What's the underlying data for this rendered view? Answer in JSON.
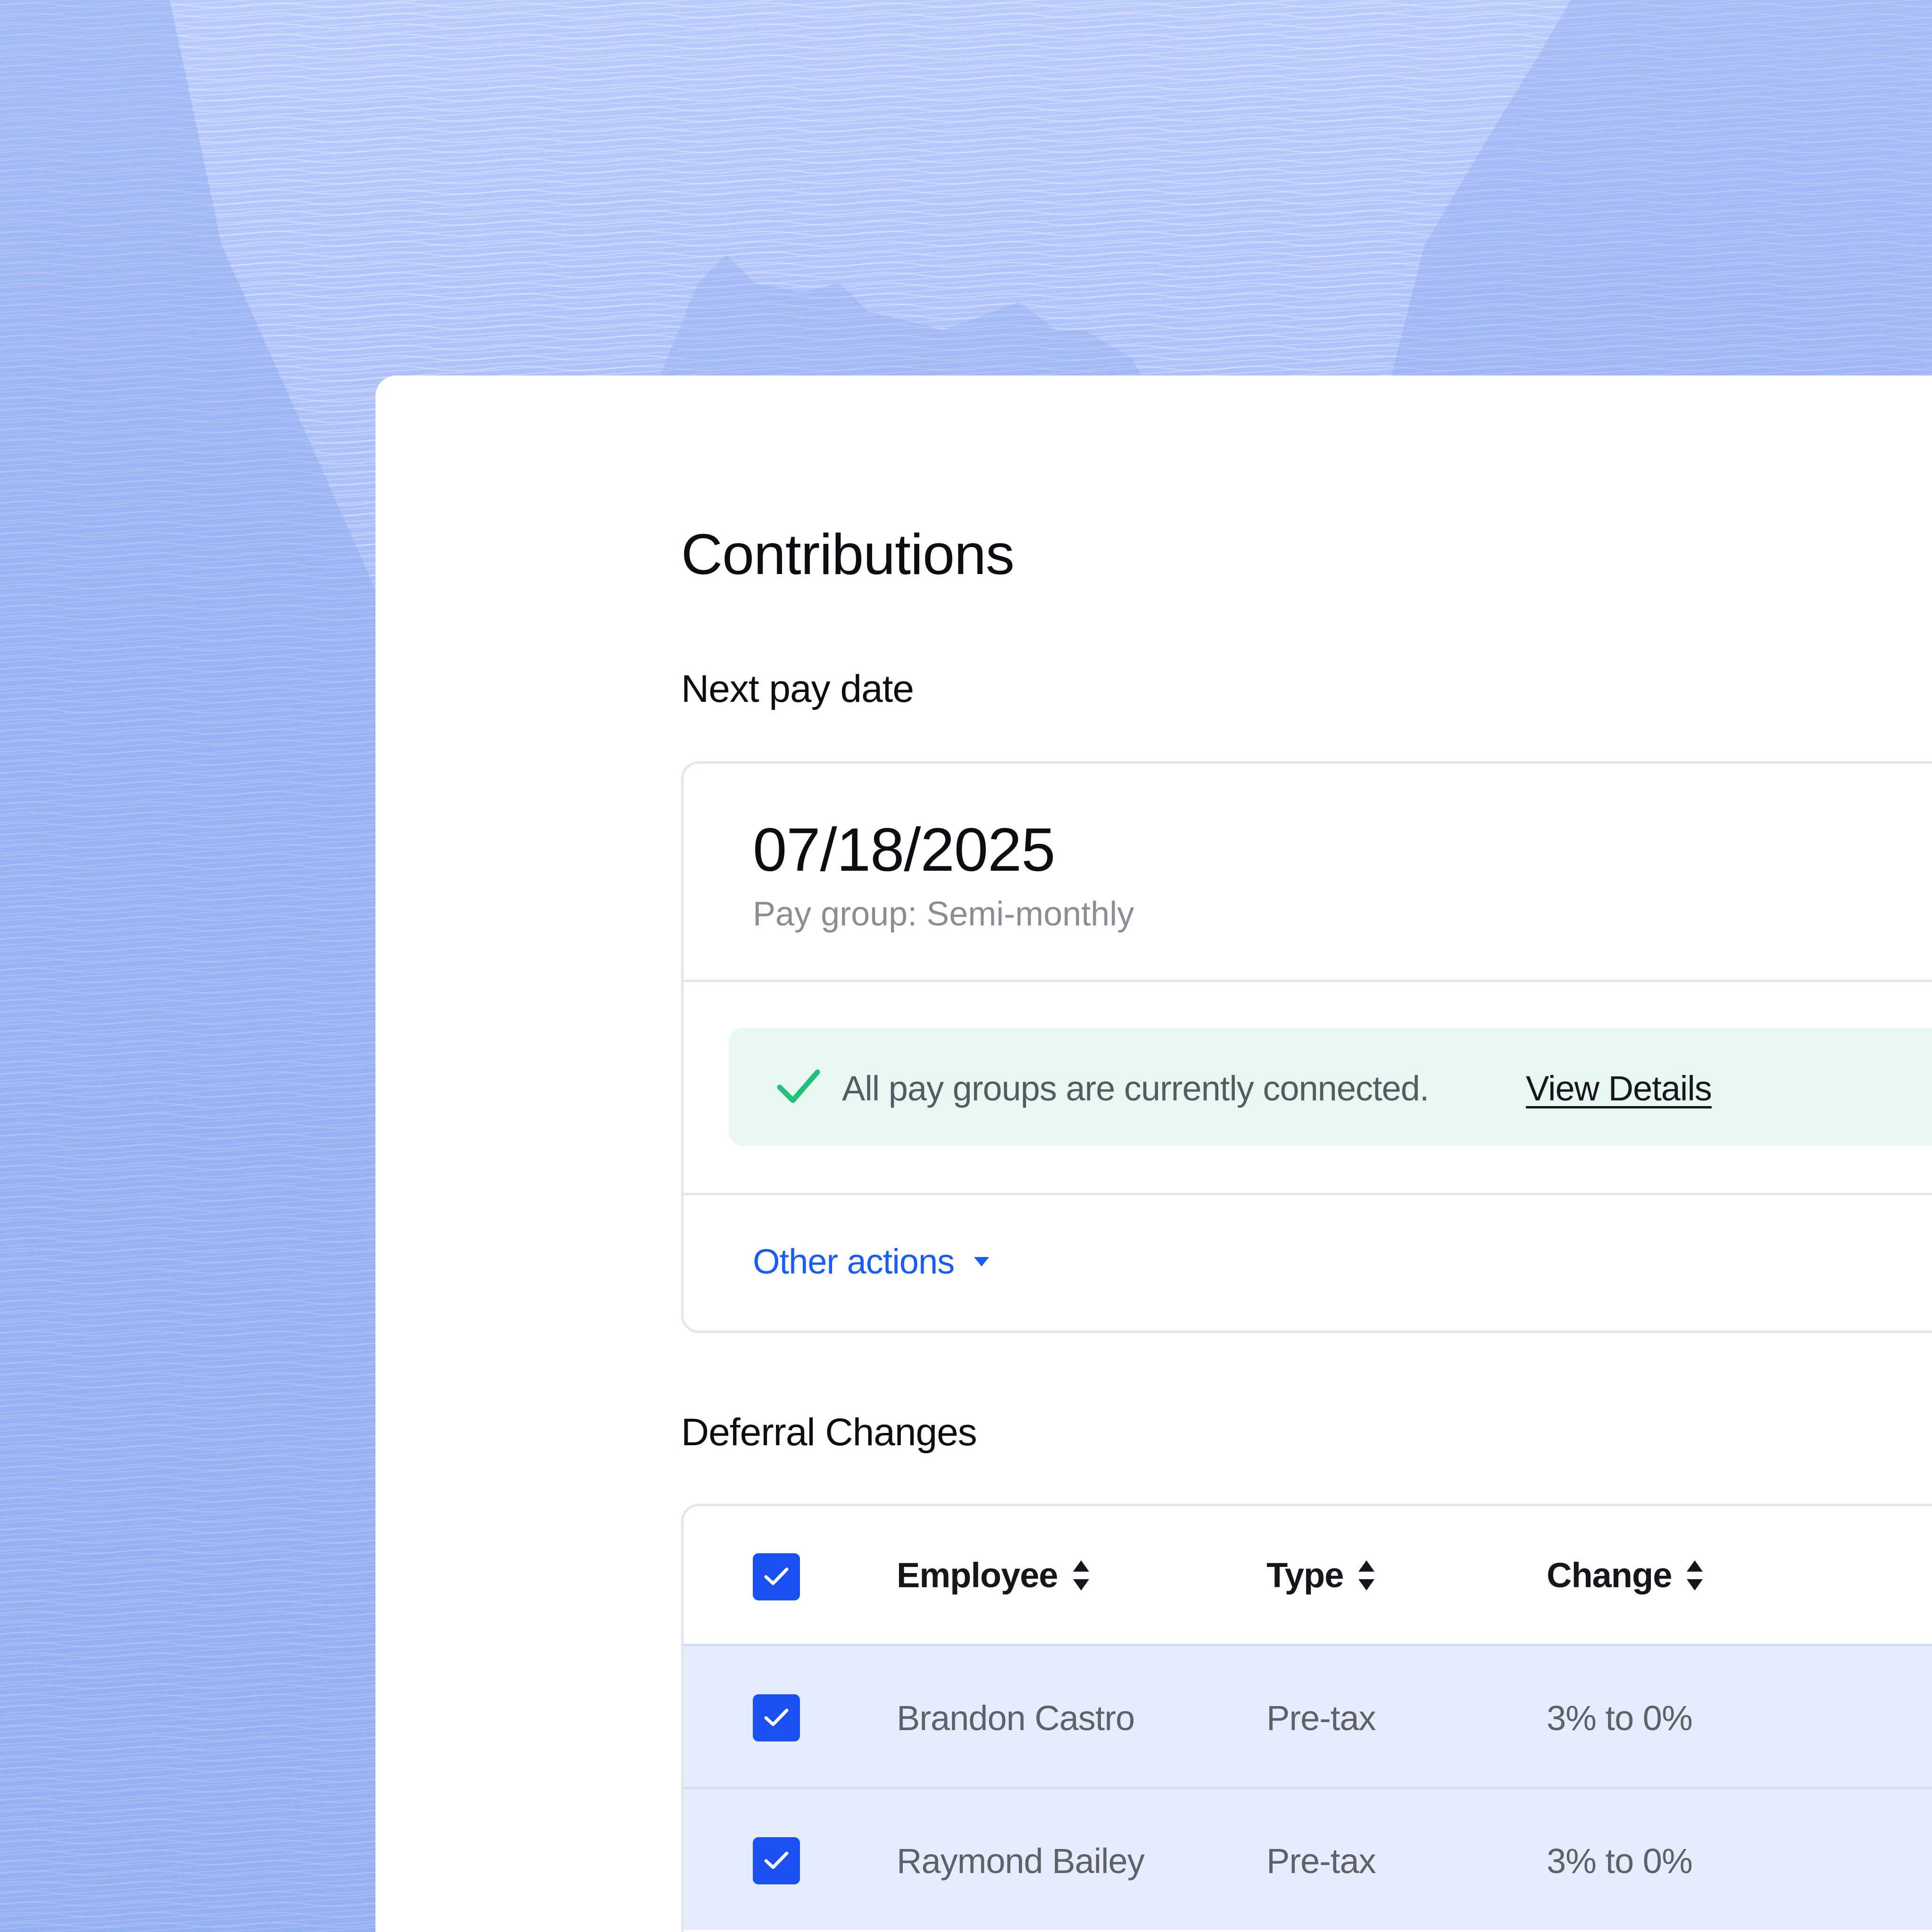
{
  "page": {
    "title": "Contributions"
  },
  "next_pay": {
    "section_title": "Next pay date",
    "date": "07/18/2025",
    "pay_group": "Pay group: Semi-monthly",
    "status": {
      "icon": "check-icon",
      "message": "All pay groups are currently connected.",
      "link_label": "View Details",
      "color": "#22c07a",
      "background": "#e6f8ef"
    },
    "other_actions_label": "Other actions"
  },
  "deferral": {
    "section_title": "Deferral Changes",
    "columns": [
      "Employee",
      "Type",
      "Change"
    ],
    "rows": [
      {
        "employee": "Brandon Castro",
        "type": "Pre-tax",
        "change": "3% to 0%",
        "checked": true
      },
      {
        "employee": "Raymond Bailey",
        "type": "Pre-tax",
        "change": "3% to 0%",
        "checked": true
      }
    ],
    "select_all_checked": true
  },
  "colors": {
    "accent": "#1a4ff0",
    "link": "#1a5cf5",
    "row_highlight": "#e7ecfd",
    "background": "#a9bdf7"
  }
}
